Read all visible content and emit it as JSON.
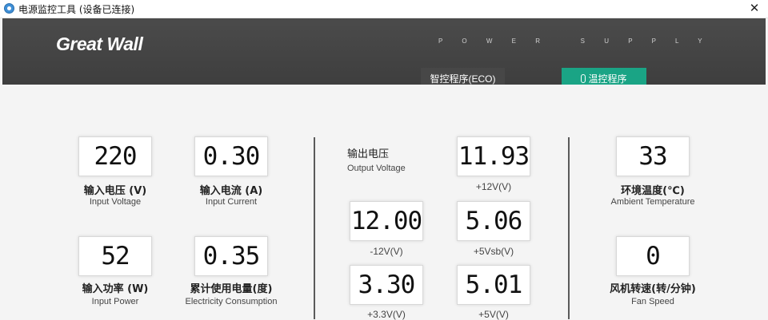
{
  "window": {
    "title": "电源监控工具 (设备已连接)",
    "close_glyph": "✕"
  },
  "header": {
    "brand": "Great Wall",
    "tagline": "P O W E R   S U P P L Y",
    "tabs": {
      "eco": "智控程序(ECO)",
      "temp": "温控程序"
    }
  },
  "input": {
    "voltage": {
      "value": "220",
      "cn": "输入电压 (V)",
      "en": "Input Voltage"
    },
    "current": {
      "value": "0.30",
      "cn": "输入电流 (A)",
      "en": "Input Current"
    },
    "power": {
      "value": "52",
      "cn": "输入功率 (W)",
      "en": "Input Power"
    },
    "consumption": {
      "value": "0.35",
      "cn": "累计使用电量(度)",
      "en": "Electricity Consumption"
    }
  },
  "output": {
    "title_cn": "输出电压",
    "title_en": "Output Voltage",
    "p12": {
      "value": "11.93",
      "label": "+12V(V)"
    },
    "n12": {
      "value": "12.00",
      "label": "-12V(V)"
    },
    "p5vsb": {
      "value": "5.06",
      "label": "+5Vsb(V)"
    },
    "p33": {
      "value": "3.30",
      "label": "+3.3V(V)"
    },
    "p5": {
      "value": "5.01",
      "label": "+5V(V)"
    }
  },
  "ambient": {
    "temperature": {
      "value": "33",
      "cn": "环境温度(℃)",
      "en": "Ambient Temperature"
    },
    "fan": {
      "value": "0",
      "cn": "风机转速(转/分钟)",
      "en": "Fan Speed"
    }
  },
  "colors": {
    "header_bg": "#444444",
    "accent_teal": "#1aa485",
    "divider": "#5a5a5a"
  }
}
